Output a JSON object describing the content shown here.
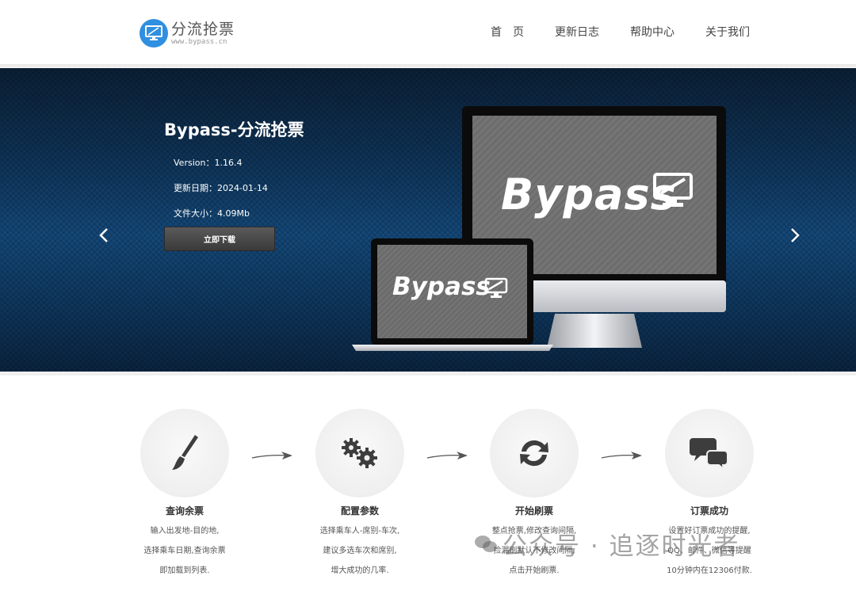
{
  "header": {
    "logo_name": "分流抢票",
    "logo_url": "www.bypass.cn",
    "nav": [
      "首　页",
      "更新日志",
      "帮助中心",
      "关于我们"
    ]
  },
  "banner": {
    "title": "Bypass-分流抢票",
    "version": "Version：1.16.4",
    "update_date": "更新日期：2024-01-14",
    "file_size": "文件大小：4.09Mb",
    "download_label": "立即下载",
    "screen_brand": "Bypass"
  },
  "steps": [
    {
      "title": "查询余票",
      "icon": "brush-icon",
      "lines": [
        "输入出发地-目的地,",
        "选择乘车日期,查询余票",
        "即加载到列表."
      ]
    },
    {
      "title": "配置参数",
      "icon": "gears-icon",
      "lines": [
        "选择乘车人-席别-车次,",
        "建议多选车次和席别,",
        "增大成功的几率."
      ]
    },
    {
      "title": "开始刷票",
      "icon": "refresh-icon",
      "lines": [
        "整点抢票,修改查询间隔,",
        "捡漏刷默认不修改间隔,",
        "点击开始刷票."
      ]
    },
    {
      "title": "订票成功",
      "icon": "chat-bubbles-icon",
      "lines": [
        "设置好订票成功的提醒,",
        "QQ、邮件、微信等提醒",
        "10分钟内在12306付款."
      ]
    }
  ],
  "watermark": "公众号 · 追逐时光者",
  "colors": {
    "brand_blue": "#2f8fe0",
    "banner_dark": "#0f3458",
    "button_dark": "#444444"
  }
}
